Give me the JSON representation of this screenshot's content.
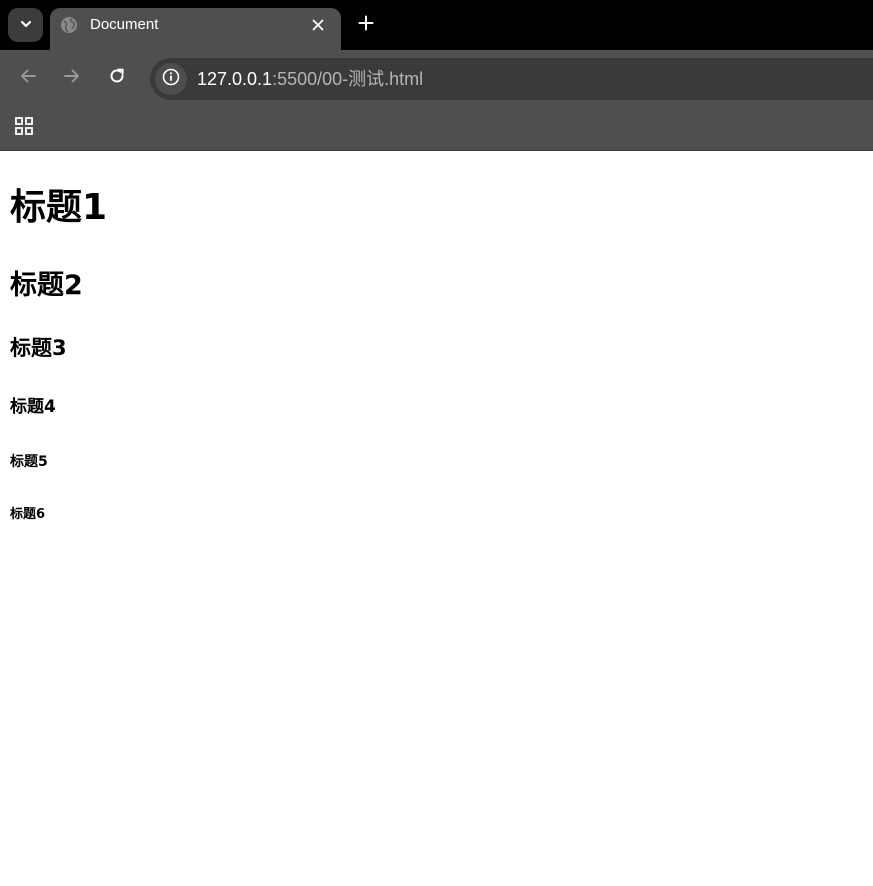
{
  "browser": {
    "tab": {
      "title": "Document",
      "favicon": "globe-icon",
      "close_icon": "close-icon"
    },
    "new_tab_icon": "plus-icon",
    "tab_search_icon": "chevron-down-icon",
    "toolbar": {
      "back_icon": "arrow-left-icon",
      "forward_icon": "arrow-right-icon",
      "reload_icon": "reload-icon",
      "site_info_icon": "info-icon",
      "url_host": "127.0.0.1",
      "url_path": ":5500/00-测试.html"
    },
    "bookmarks": {
      "apps_icon": "apps-grid-icon"
    },
    "colors": {
      "tabstrip": "#000000",
      "toolbar": "#4f4f4f",
      "omnibox": "#3a3a3a",
      "url_host": "#ffffff",
      "url_path": "#b4b4b4"
    }
  },
  "page": {
    "headings": {
      "h1": "标题1",
      "h2": "标题2",
      "h3": "标题3",
      "h4": "标题4",
      "h5": "标题5",
      "h6": "标题6"
    }
  }
}
